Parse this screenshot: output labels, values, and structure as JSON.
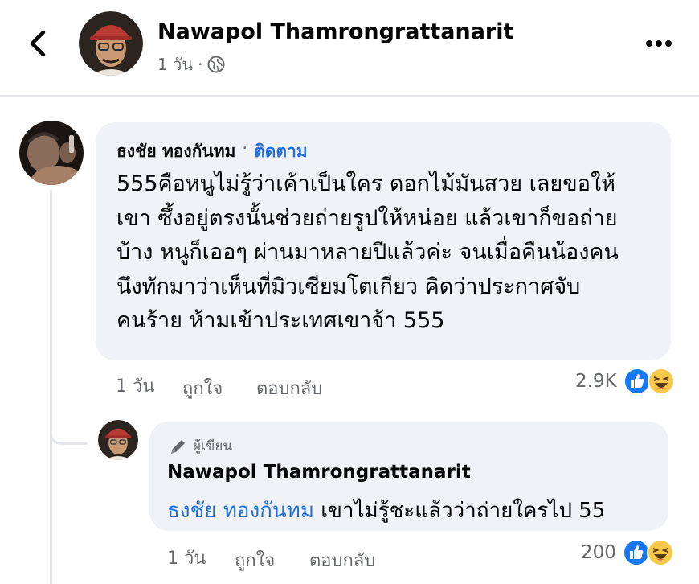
{
  "header": {
    "author_name": "Nawapol Thamrongrattanarit",
    "time": "1 วัน",
    "separator": "·"
  },
  "comment": {
    "author": "ธงชัย ทองกันทม",
    "separator": "·",
    "follow_label": "ติดตาม",
    "lines": [
      "555คือหนูไม่รู้ว่าเค้าเป็นใคร ดอกไม้มันสวย เลยขอให้",
      "เขา ซึ้งอยู่ตรงนั้นช่วยถ่ายรูปให้หน่อย แล้วเขาก็ขอถ่าย",
      "บ้าง หนูก็เออๆ ผ่านมาหลายปีแล้วค่ะ จนเมื่อคืนน้องคน",
      "นึงทักมาว่าเห็นที่มิวเซียมโตเกียว คิดว่าประกาศจับ",
      "คนร้าย ห้ามเข้าประเทศเขาจ้า 555"
    ],
    "time": "1 วัน",
    "like_label": "ถูกใจ",
    "reply_label": "ตอบกลับ",
    "reaction_count": "2.9K",
    "reaction_icons": [
      "like-icon",
      "haha-icon"
    ]
  },
  "reply": {
    "badge": "ผู้เขียน",
    "author": "Nawapol Thamrongrattanarit",
    "mention": "ธงชัย ทองกันทม",
    "text": " เขาไม่รู้ชะแล้วว่าถ่ายใครไป 55",
    "time": "1 วัน",
    "like_label": "ถูกใจ",
    "reply_label": "ตอบกลับ",
    "reaction_count": "200",
    "reaction_icons": [
      "like-icon",
      "haha-icon"
    ]
  }
}
